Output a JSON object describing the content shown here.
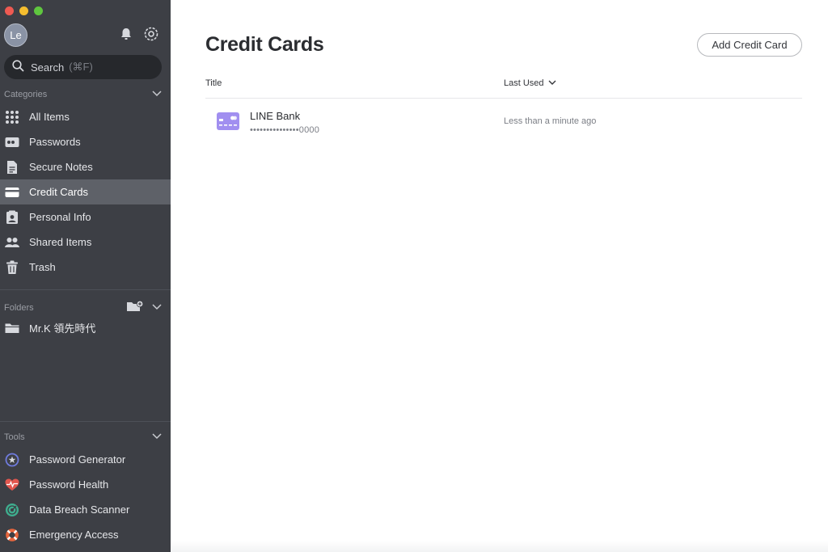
{
  "user": {
    "avatar_initials": "Le"
  },
  "search": {
    "label": "Search",
    "shortcut": "(⌘F)"
  },
  "categories": {
    "heading": "Categories",
    "items": [
      {
        "label": "All Items",
        "icon": "grid-icon"
      },
      {
        "label": "Passwords",
        "icon": "password-icon"
      },
      {
        "label": "Secure Notes",
        "icon": "note-icon"
      },
      {
        "label": "Credit Cards",
        "icon": "credit-card-icon",
        "active": true
      },
      {
        "label": "Personal Info",
        "icon": "id-card-icon"
      },
      {
        "label": "Shared Items",
        "icon": "people-icon"
      },
      {
        "label": "Trash",
        "icon": "trash-icon"
      }
    ]
  },
  "folders": {
    "heading": "Folders",
    "items": [
      {
        "label": "Mr.K 領先時代",
        "icon": "folder-icon"
      }
    ]
  },
  "tools": {
    "heading": "Tools",
    "items": [
      {
        "label": "Password Generator",
        "icon": "generator-icon",
        "color": "#6f7bdc"
      },
      {
        "label": "Password Health",
        "icon": "heart-pulse-icon",
        "color": "#e2574f"
      },
      {
        "label": "Data Breach Scanner",
        "icon": "radar-icon",
        "color": "#3fae8f"
      },
      {
        "label": "Emergency Access",
        "icon": "lifebuoy-icon",
        "color": "#e8663d"
      }
    ]
  },
  "main": {
    "title": "Credit Cards",
    "add_button": "Add Credit Card",
    "columns": {
      "title": "Title",
      "last_used": "Last Used"
    },
    "rows": [
      {
        "name": "LINE Bank",
        "number": "•••••••••••••••0000",
        "last_used": "Less than a minute ago",
        "icon_color": "#a18ff0"
      }
    ]
  },
  "colors": {
    "sidebar_bg": "#3d3f45",
    "active_item": "#5e6168",
    "accent_card": "#a18ff0"
  }
}
